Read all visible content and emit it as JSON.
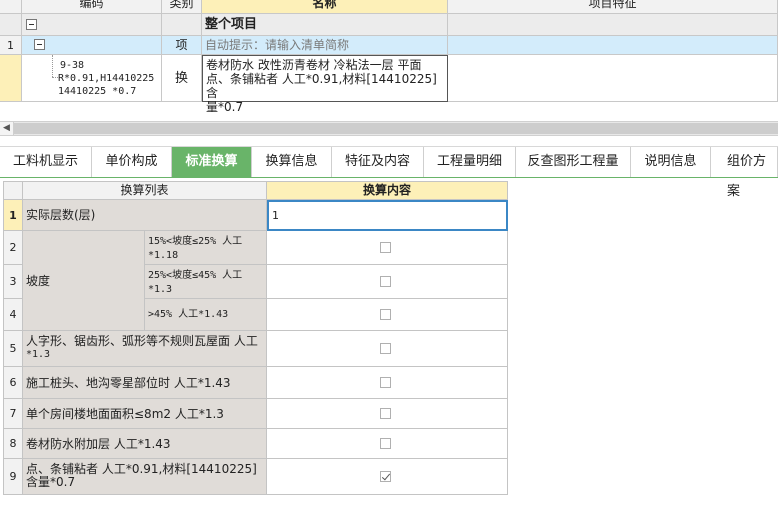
{
  "top_grid": {
    "headers": {
      "code": "编码",
      "category": "类别",
      "name": "名称",
      "feature": "项目特征"
    },
    "group_row": {
      "name": "整个项目"
    },
    "row1": {
      "num": "1",
      "category": "项",
      "name": "自动提示：请输入清单简称"
    },
    "row2": {
      "code_lines": [
        "9-38",
        "R*0.91,H14410225",
        "14410225 *0.7"
      ],
      "category": "换",
      "name_lines": [
        "卷材防水 改性沥青卷材 冷粘法一层 平面",
        "点、条铺粘者 人工*0.91,材料[14410225] 含",
        "量*0.7"
      ]
    }
  },
  "tabs": [
    "工料机显示",
    "单价构成",
    "标准换算",
    "换算信息",
    "特征及内容",
    "工程量明细",
    "反查图形工程量",
    "说明信息",
    "组价方案"
  ],
  "active_tab": "标准换算",
  "calc_table": {
    "header_list": "换算列表",
    "header_content": "换算内容",
    "rows": [
      {
        "num": "1",
        "label": "实际层数(层)",
        "value": "1"
      },
      {
        "num": "2",
        "sub": [
          "15%<坡度≤25% 人工",
          "*1.18"
        ],
        "checked": false
      },
      {
        "num": "3",
        "label": "坡度",
        "sub": [
          "25%<坡度≤45% 人工",
          "*1.3"
        ],
        "checked": false
      },
      {
        "num": "4",
        "sub": [
          ">45% 人工*1.43"
        ],
        "checked": false
      },
      {
        "num": "5",
        "label_lines": [
          "人字形、锯齿形、弧形等不规则瓦屋面 人工",
          "*1.3"
        ],
        "checked": false
      },
      {
        "num": "6",
        "label_lines": [
          "施工桩头、地沟零星部位时 人工*1.43"
        ],
        "checked": false
      },
      {
        "num": "7",
        "label_lines": [
          "单个房间楼地面面积≤8m2 人工*1.3"
        ],
        "checked": false
      },
      {
        "num": "8",
        "label_lines": [
          "卷材防水附加层 人工*1.43"
        ],
        "checked": false
      },
      {
        "num": "9",
        "label_lines": [
          "点、条铺粘者 人工*0.91,材料[14410225]",
          "含量*0.7"
        ],
        "checked": true
      }
    ]
  },
  "colors": {
    "tab_active": "#69b469",
    "header_yellow": "#fdf0b8",
    "row_blue": "#d3ecfb",
    "gray_cell": "#e0dcd8",
    "input_border": "#3b87c5"
  }
}
